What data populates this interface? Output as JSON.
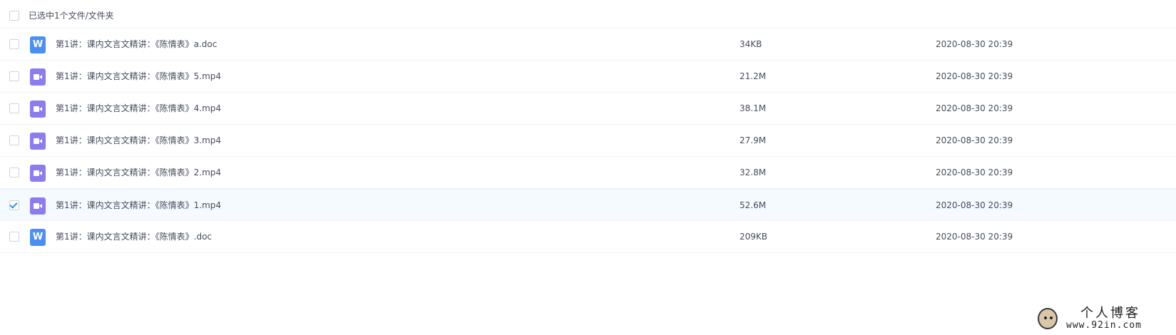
{
  "header": {
    "selection_label": "已选中1个文件/文件夹"
  },
  "files": [
    {
      "name": "第1讲：课内文言文精讲：《陈情表》a.doc",
      "size": "34KB",
      "date": "2020-08-30 20:39",
      "type": "doc",
      "icon": "word-doc-icon",
      "icon_letter": "W",
      "selected": false
    },
    {
      "name": "第1讲：课内文言文精讲：《陈情表》5.mp4",
      "size": "21.2M",
      "date": "2020-08-30 20:39",
      "type": "video",
      "icon": "video-file-icon",
      "selected": false
    },
    {
      "name": "第1讲：课内文言文精讲：《陈情表》4.mp4",
      "size": "38.1M",
      "date": "2020-08-30 20:39",
      "type": "video",
      "icon": "video-file-icon",
      "selected": false
    },
    {
      "name": "第1讲：课内文言文精讲：《陈情表》3.mp4",
      "size": "27.9M",
      "date": "2020-08-30 20:39",
      "type": "video",
      "icon": "video-file-icon",
      "selected": false
    },
    {
      "name": "第1讲：课内文言文精讲：《陈情表》2.mp4",
      "size": "32.8M",
      "date": "2020-08-30 20:39",
      "type": "video",
      "icon": "video-file-icon",
      "selected": false
    },
    {
      "name": "第1讲：课内文言文精讲：《陈情表》1.mp4",
      "size": "52.6M",
      "date": "2020-08-30 20:39",
      "type": "video",
      "icon": "video-file-icon",
      "selected": true
    },
    {
      "name": "第1讲：课内文言文精讲：《陈情表》.doc",
      "size": "209KB",
      "date": "2020-08-30 20:39",
      "type": "doc",
      "icon": "word-doc-icon",
      "icon_letter": "W",
      "selected": false
    }
  ],
  "watermark": {
    "title": "个人博客",
    "url": "www.92in.com"
  },
  "colors": {
    "doc_icon": "#4a8ff5",
    "video_icon": "#8b7cf0",
    "check_accent": "#2f8ef7",
    "selected_row_bg": "#f5faff",
    "text": "#454d5a"
  }
}
